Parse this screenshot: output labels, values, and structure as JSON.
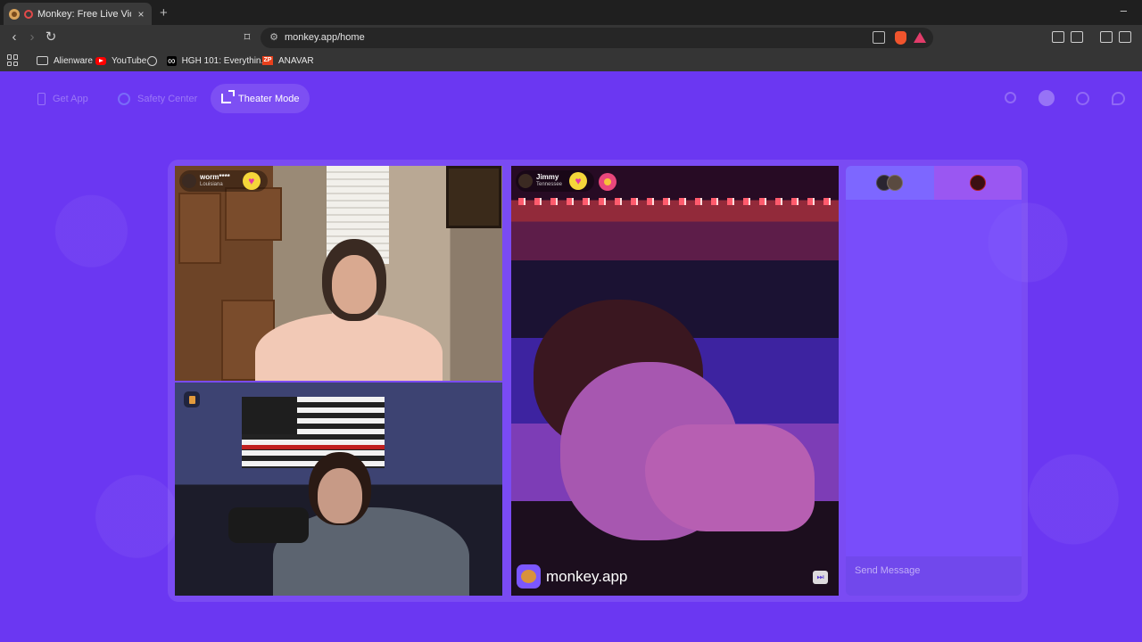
{
  "browser": {
    "tab_title": "Monkey: Free Live Video Chat",
    "tab_close": "×",
    "new_tab": "+",
    "minimize": "–",
    "url": "monkey.app/home",
    "bookmarks": [
      {
        "label": "Alienware",
        "icon": "folder-icon"
      },
      {
        "label": "YouTube",
        "icon": "youtube-icon"
      },
      {
        "label": "",
        "icon": "globe-icon"
      },
      {
        "label": "HGH 101: Everythin...",
        "icon": "infinity-icon"
      },
      {
        "label": "ANAVAR",
        "icon": "zp-icon"
      }
    ]
  },
  "nav": {
    "get_app": "Get App",
    "safety_center": "Safety Center",
    "theater_mode": "Theater Mode"
  },
  "videos": {
    "top_left": {
      "name": "worm****",
      "location": "Louisiana"
    },
    "right": {
      "name": "Jimmy",
      "location": "Tennessee"
    },
    "watermark": "monkey.app"
  },
  "chat": {
    "placeholder": "Send Message"
  },
  "colors": {
    "page_bg": "#6b37f2",
    "accent": "#f5d63a"
  }
}
